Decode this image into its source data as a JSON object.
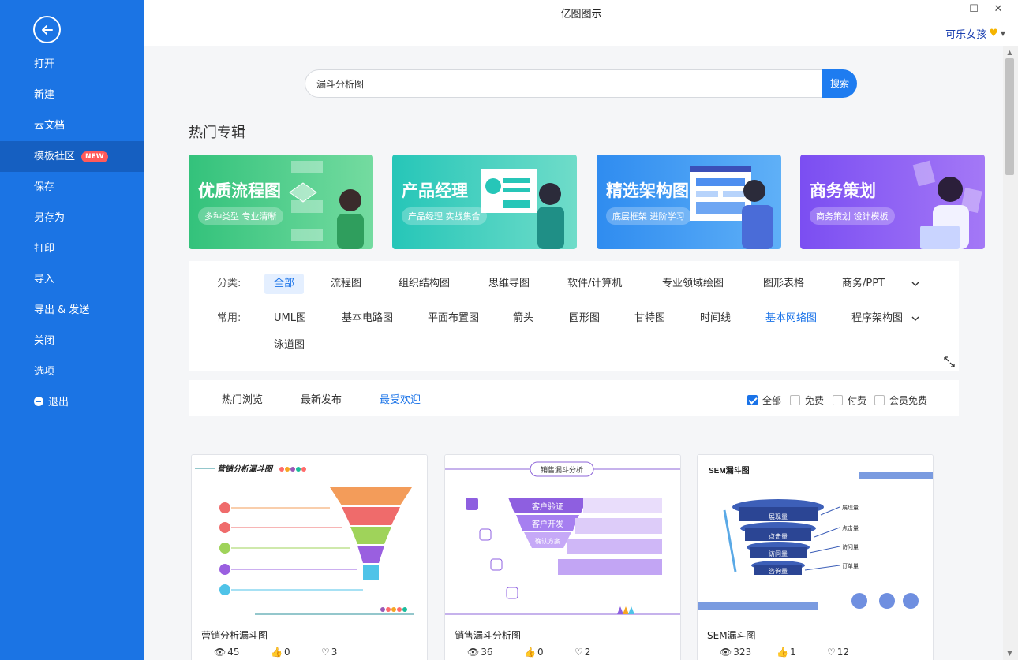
{
  "app": {
    "title": "亿图图示",
    "user": "可乐女孩"
  },
  "sidebar": {
    "items": [
      {
        "label": "打开"
      },
      {
        "label": "新建"
      },
      {
        "label": "云文档"
      },
      {
        "label": "模板社区",
        "badge": "NEW",
        "active": true
      },
      {
        "label": "保存"
      },
      {
        "label": "另存为"
      },
      {
        "label": "打印"
      },
      {
        "label": "导入"
      },
      {
        "label": "导出 & 发送"
      },
      {
        "label": "关闭"
      },
      {
        "label": "选项"
      },
      {
        "label": "退出"
      }
    ]
  },
  "search": {
    "value": "漏斗分析图",
    "button": "搜索"
  },
  "section_title": "热门专辑",
  "banners": [
    {
      "title": "优质流程图",
      "subtitle": "多种类型 专业清晰"
    },
    {
      "title": "产品经理",
      "subtitle": "产品经理 实战集合"
    },
    {
      "title": "精选架构图",
      "subtitle": "底层框架 进阶学习"
    },
    {
      "title": "商务策划",
      "subtitle": "商务策划 设计模板"
    }
  ],
  "filters": {
    "category_label": "分类:",
    "categories": [
      "全部",
      "流程图",
      "组织结构图",
      "思维导图",
      "软件/计算机",
      "专业领域绘图",
      "图形表格",
      "商务/PPT"
    ],
    "common_label": "常用:",
    "common": [
      "UML图",
      "基本电路图",
      "平面布置图",
      "箭头",
      "圆形图",
      "甘特图",
      "时间线",
      "基本网络图",
      "程序架构图",
      "泳道图"
    ]
  },
  "sort_tabs": [
    "热门浏览",
    "最新发布",
    "最受欢迎"
  ],
  "price_filters": [
    {
      "label": "全部",
      "checked": true
    },
    {
      "label": "免费",
      "checked": false
    },
    {
      "label": "付费",
      "checked": false
    },
    {
      "label": "会员免费",
      "checked": false
    }
  ],
  "cards": [
    {
      "title": "营销分析漏斗图",
      "views": "45",
      "likes": "0",
      "favorites": "3",
      "thumb_title": "营销分析漏斗图"
    },
    {
      "title": "销售漏斗分析图",
      "views": "36",
      "likes": "0",
      "favorites": "2",
      "thumb_title": "销售漏斗分析",
      "labels": [
        "客户验证",
        "客户开发",
        "确认方案"
      ]
    },
    {
      "title": "SEM漏斗图",
      "views": "323",
      "likes": "1",
      "favorites": "12",
      "thumb_title": "SEM漏斗图",
      "labels": [
        "展现量",
        "点击量",
        "访问量",
        "咨询量"
      ],
      "side_labels": [
        "展现量",
        "点击量",
        "访问量",
        "订单量"
      ]
    }
  ]
}
